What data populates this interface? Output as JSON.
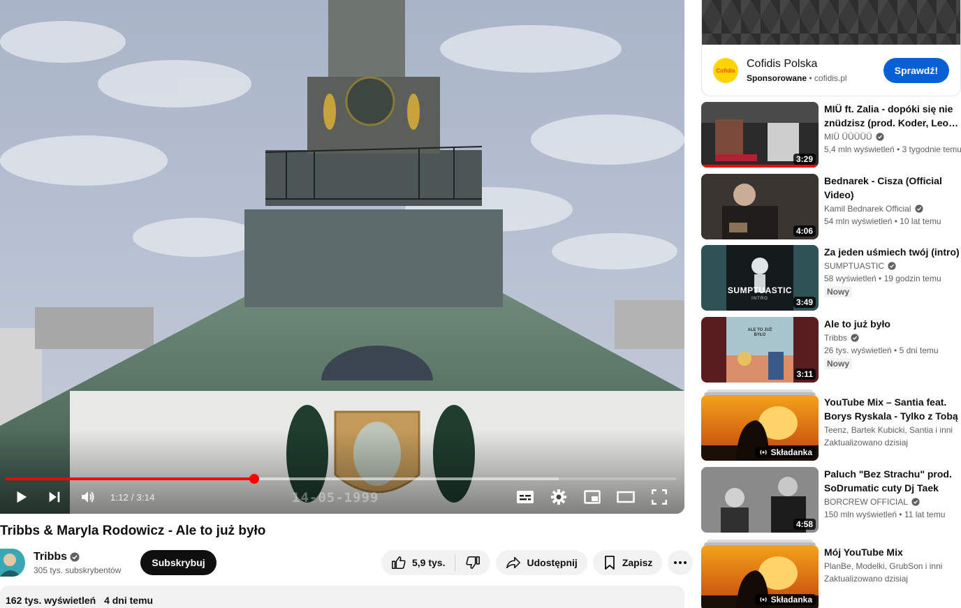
{
  "player": {
    "time_current": "1:12",
    "time_total": "3:14",
    "time_label": "1:12 / 3:14",
    "progress_fraction": 0.371,
    "buffered_fraction": 0.825,
    "overlay_date": "14-05-1999"
  },
  "video": {
    "title": "Tribbs & Maryla Rodowicz - Ale to już było",
    "channel": "Tribbs",
    "subscribers": "305 tys. subskrybentów",
    "subscribe_label": "Subskrybuj",
    "likes": "5,9 tys.",
    "share_label": "Udostępnij",
    "save_label": "Zapisz",
    "views": "162 tys. wyświetleń",
    "posted": "4 dni temu"
  },
  "ad": {
    "advertiser": "Cofidis Polska",
    "logo_text": "Cofidis",
    "sponsored_label": "Sponsorowane",
    "domain": "cofidis.pl",
    "cta_label": "Sprawdź!"
  },
  "recommendations": [
    {
      "title": "MIÜ ft. Zalia - dopóki się nie znüdzisz (prod. Koder, Leon ...",
      "channel": "MIÜ ÜÜÜÜÜ",
      "verified": true,
      "meta": "5,4 mln wyświetleń • 3 tygodnie temu",
      "duration": "3:29",
      "watched_fraction": 1.0
    },
    {
      "title": "Bednarek - Cisza (Official Video)",
      "channel": "Kamil Bednarek Official",
      "verified": true,
      "meta": "54 mln wyświetleń • 10 lat temu",
      "duration": "4:06"
    },
    {
      "title": "Za jeden uśmiech twój (intro)",
      "channel": "SUMPTUASTIC",
      "verified": true,
      "meta": "58 wyświetleń • 19 godzin temu",
      "duration": "3:49",
      "badge": "Nowy",
      "thumb_text": "SUMPTUASTIC",
      "thumb_subtext": "INTRO"
    },
    {
      "title": "Ale to już było",
      "channel": "Tribbs",
      "verified": true,
      "meta": "26 tys. wyświetleń • 5 dni temu",
      "duration": "3:11",
      "badge": "Nowy",
      "thumb_text": "ALE TO JUŻ BYŁO"
    },
    {
      "title": "YouTube Mix – Santia feat. Borys Ryskala - Tylko z Tobą",
      "channel": "Teenz, Bartek Kubicki, Santia i inni",
      "meta": "Zaktualizowano dzisiaj",
      "mix_label": "Składanka"
    },
    {
      "title": "Paluch \"Bez Strachu\" prod. SoDrumatic cuty Dj Taek",
      "channel": "BORCREW OFFICIAL",
      "verified": true,
      "meta": "150 mln wyświetleń • 11 lat temu",
      "duration": "4:58"
    },
    {
      "title": "Mój YouTube Mix",
      "channel": "PlanBe, Modelki, GrubSon i inni",
      "meta": "Zaktualizowano dzisiaj",
      "mix_label": "Składanka"
    }
  ],
  "icons": {
    "play": "play-icon",
    "next": "next-icon",
    "volume": "volume-icon",
    "subtitles": "subtitles-icon",
    "settings": "gear-icon",
    "miniplayer": "miniplayer-icon",
    "theater": "theater-icon",
    "fullscreen": "fullscreen-icon",
    "like": "thumb-up-icon",
    "dislike": "thumb-down-icon",
    "share": "share-icon",
    "save": "bookmark-icon",
    "more": "more-icon",
    "verified": "verified-icon",
    "mix": "broadcast-icon"
  },
  "colors": {
    "accent_red": "#ff0000",
    "subscribe_bg": "#0f0f0f",
    "cta_blue": "#065fd4",
    "secondary_text": "#606060",
    "chip_bg": "#f2f2f2"
  }
}
